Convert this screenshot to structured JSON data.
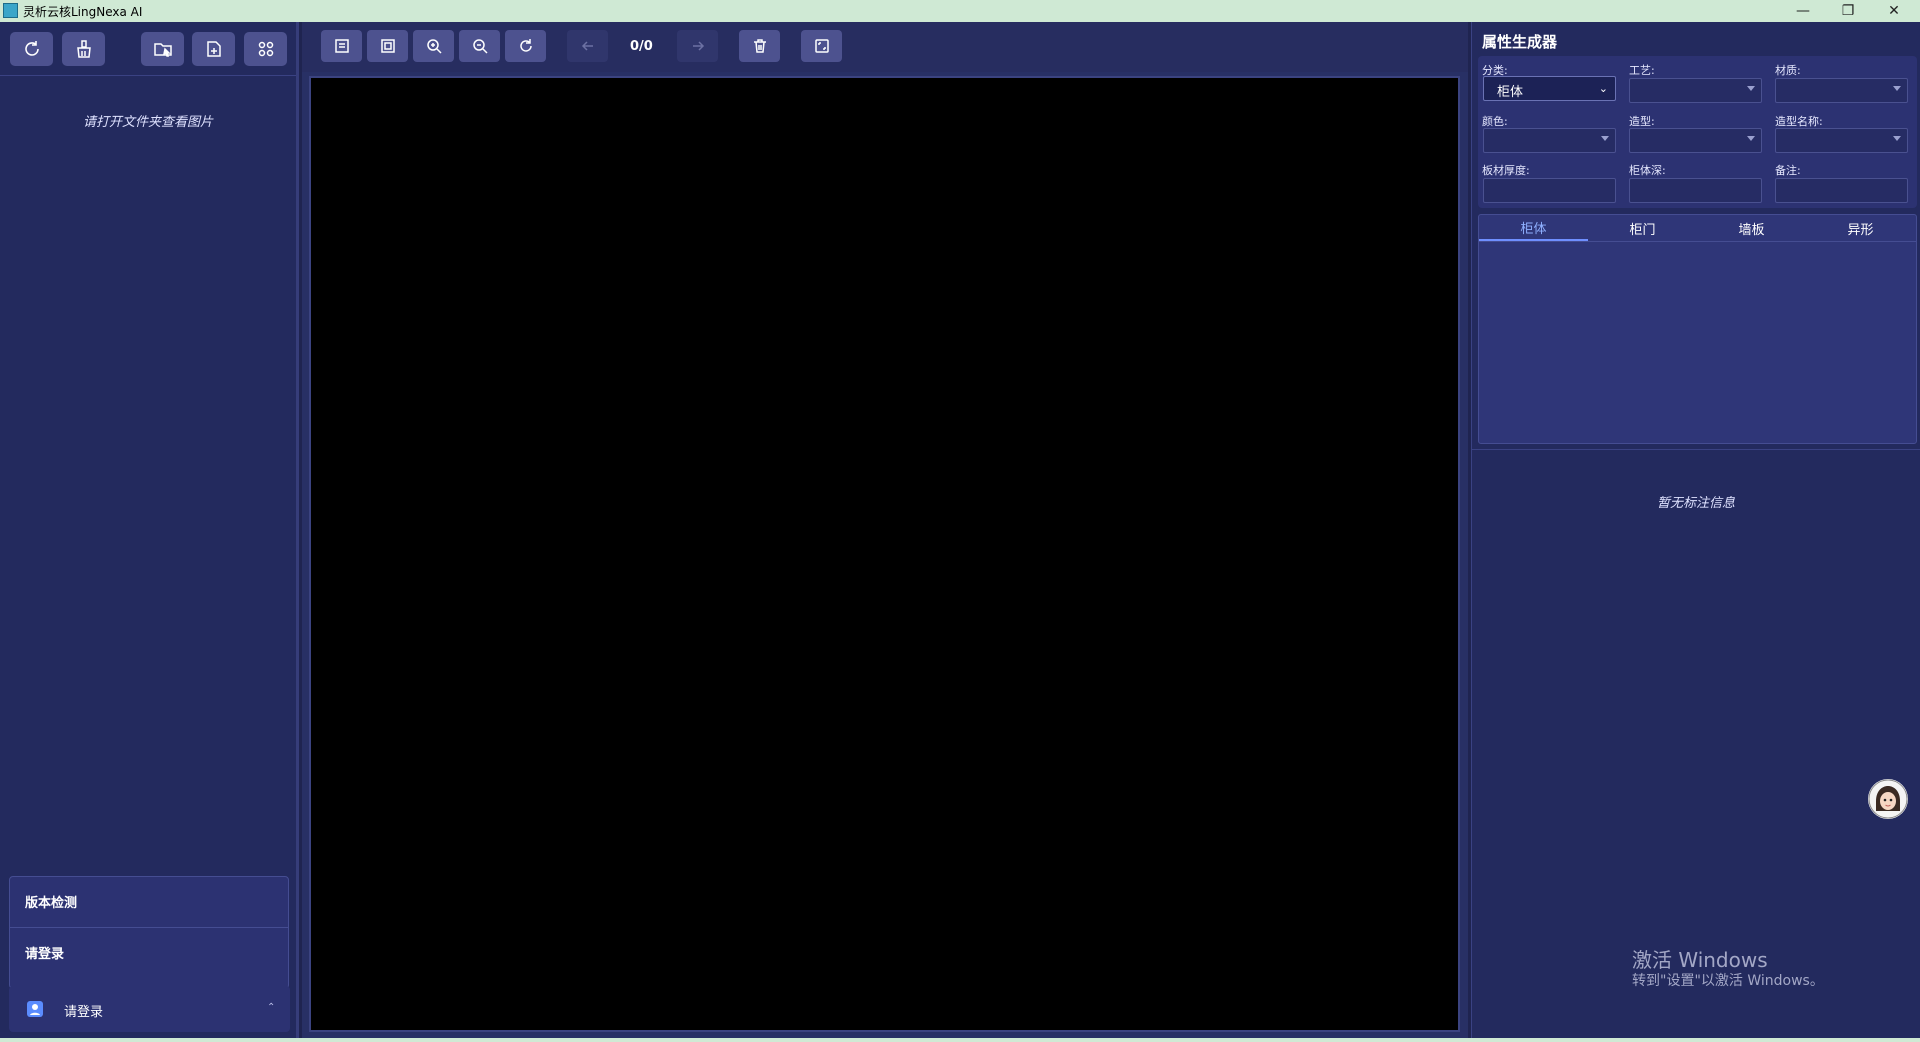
{
  "window": {
    "title": "灵析云核LingNexa AI",
    "minimize": "—",
    "maximize": "❐",
    "close": "✕"
  },
  "left": {
    "empty_message": "请打开文件夹查看图片",
    "toolbar_icons": [
      "refresh-icon",
      "clean-icon",
      "open-folder-icon",
      "export-file-icon",
      "settings-plugin-icon"
    ],
    "popup": {
      "version_check": "版本检测",
      "login": "请登录"
    },
    "user": {
      "label": "请登录",
      "caret": "⌃"
    }
  },
  "center": {
    "toolbar_icons": [
      "fit-window-icon",
      "actual-size-icon",
      "zoom-in-icon",
      "zoom-out-icon",
      "rotate-icon",
      "prev-icon",
      "next-icon",
      "delete-icon",
      "fullscreen-icon"
    ],
    "counter": "0/0"
  },
  "right": {
    "title": "属性生成器",
    "fields": {
      "category_label": "分类:",
      "category_value": "柜体",
      "craft_label": "工艺:",
      "material_label": "材质:",
      "color_label": "颜色:",
      "shape_label": "造型:",
      "shape_name_label": "造型名称:",
      "board_thickness_label": "板材厚度:",
      "cabinet_depth_label": "柜体深:",
      "remark_label": "备注:"
    },
    "tabs": [
      "柜体",
      "柜门",
      "墙板",
      "异形"
    ],
    "active_tab": "柜体",
    "empty_annotation": "暂无标注信息"
  },
  "watermark": {
    "line1": "激活 Windows",
    "line2": "转到\"设置\"以激活 Windows。"
  },
  "colors": {
    "background": "#1f2450",
    "button": "#4d528f",
    "accent_tab": "#8fb0ff",
    "canvas": "#000000",
    "titlebar": "#cfe9d4"
  }
}
